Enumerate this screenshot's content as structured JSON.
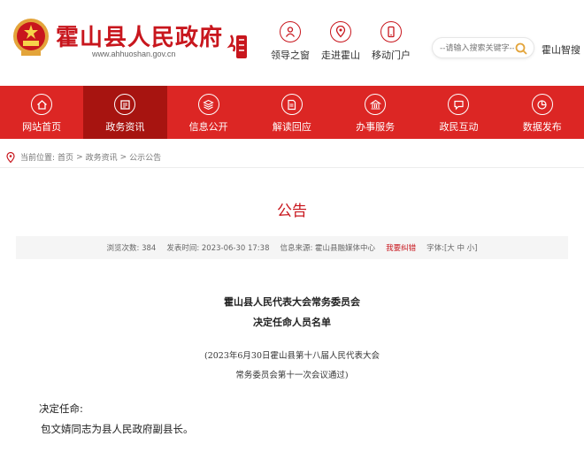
{
  "header": {
    "site_title": "霍山县人民政府",
    "site_url": "www.ahhuoshan.gov.cn",
    "links": [
      {
        "label": "领导之窗",
        "icon": "leader-icon"
      },
      {
        "label": "走进霍山",
        "icon": "location-icon"
      },
      {
        "label": "移动门户",
        "icon": "mobile-icon"
      }
    ],
    "search": {
      "placeholder": "--请输入搜索关键字--"
    },
    "smart_label": "霍山智搜"
  },
  "nav": [
    {
      "label": "网站首页",
      "icon": "home-icon",
      "active": false
    },
    {
      "label": "政务资讯",
      "icon": "news-icon",
      "active": true
    },
    {
      "label": "信息公开",
      "icon": "layers-icon",
      "active": false
    },
    {
      "label": "解读回应",
      "icon": "document-icon",
      "active": false
    },
    {
      "label": "办事服务",
      "icon": "building-icon",
      "active": false
    },
    {
      "label": "政民互动",
      "icon": "chat-icon",
      "active": false
    },
    {
      "label": "数据发布",
      "icon": "data-icon",
      "active": false
    }
  ],
  "breadcrumb": {
    "prefix": "当前位置:",
    "items": [
      "首页",
      ">",
      "政务资讯",
      ">",
      "公示公告"
    ]
  },
  "article": {
    "title": "公告",
    "meta": {
      "views": "浏览次数: 384",
      "published": "发表时间: 2023-06-30 17:38",
      "source": "信息来源: 霍山县融媒体中心",
      "report": "我要纠错",
      "font": "字体:[大 中 小]"
    },
    "heading_1": "霍山县人民代表大会常务委员会",
    "heading_2": "决定任命人员名单",
    "sub_1": "(2023年6月30日霍山县第十八届人民代表大会",
    "sub_2": "常务委员会第十一次会议通过)",
    "body_1": "决定任命:",
    "body_2": "包文婧同志为县人民政府副县长。"
  },
  "colors": {
    "brand_red": "#dc2624",
    "active_red": "#a71410",
    "title_red": "#c8161d"
  }
}
